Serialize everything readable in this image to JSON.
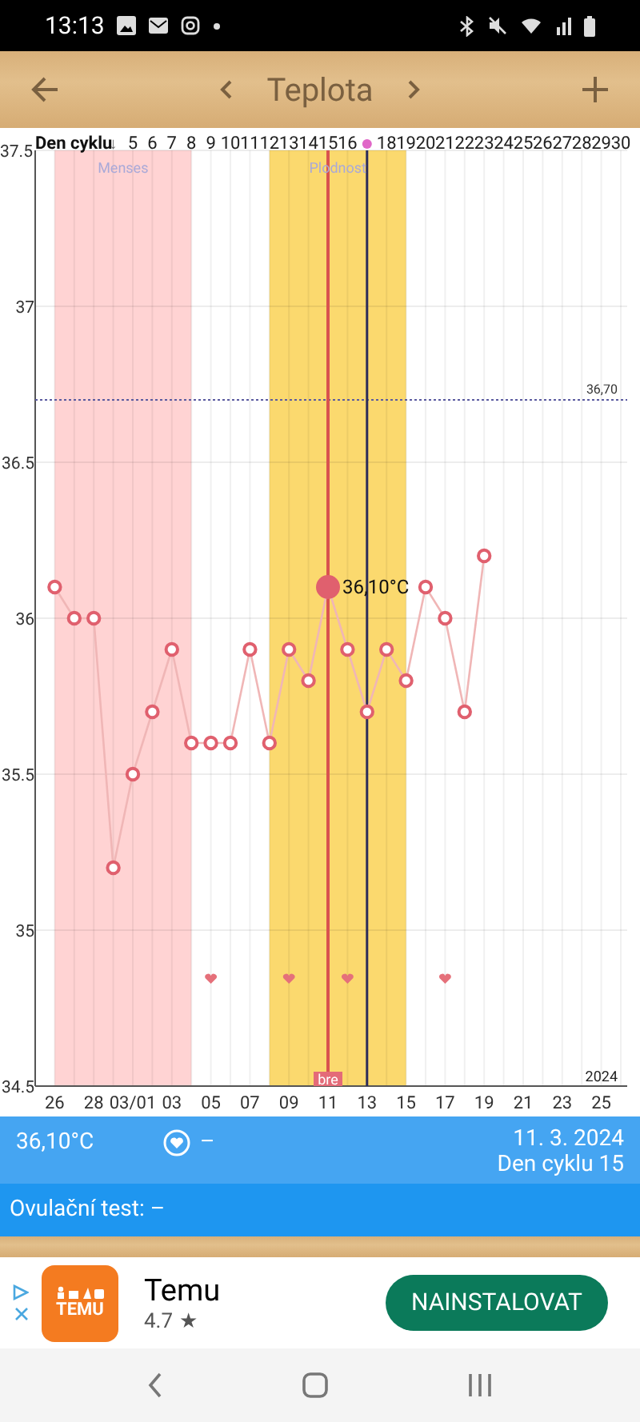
{
  "status_bar": {
    "time": "13:13"
  },
  "header": {
    "title": "Teplota"
  },
  "chart": {
    "cycle_header": {
      "title": "Den cyklu",
      "arrow": "↓",
      "days": [
        {
          "kind": "number",
          "label": "5",
          "heart": false,
          "selected": false
        },
        {
          "kind": "number",
          "label": "6",
          "heart": false,
          "selected": false
        },
        {
          "kind": "number",
          "label": "7",
          "heart": false,
          "selected": false
        },
        {
          "kind": "number",
          "label": "8",
          "heart": false,
          "selected": false
        },
        {
          "kind": "number",
          "label": "9",
          "heart": true,
          "selected": false
        },
        {
          "kind": "number",
          "label": "10",
          "heart": false,
          "selected": false
        },
        {
          "kind": "number",
          "label": "11",
          "heart": false,
          "selected": false
        },
        {
          "kind": "number",
          "label": "12",
          "heart": false,
          "selected": false
        },
        {
          "kind": "number",
          "label": "13",
          "heart": true,
          "selected": false
        },
        {
          "kind": "number",
          "label": "14",
          "heart": false,
          "selected": false
        },
        {
          "kind": "number",
          "label": "15",
          "heart": false,
          "selected": true
        },
        {
          "kind": "number",
          "label": "16",
          "heart": true,
          "selected": false
        },
        {
          "kind": "today",
          "heart": false,
          "selected": false
        },
        {
          "kind": "number",
          "label": "18",
          "heart": false,
          "selected": false
        },
        {
          "kind": "number",
          "label": "19",
          "heart": false,
          "selected": false
        },
        {
          "kind": "number",
          "label": "20",
          "heart": false,
          "selected": false
        },
        {
          "kind": "number",
          "label": "21",
          "heart": true,
          "selected": false
        },
        {
          "kind": "number",
          "label": "22",
          "heart": false,
          "selected": false
        },
        {
          "kind": "number",
          "label": "23",
          "heart": false,
          "selected": false
        },
        {
          "kind": "number",
          "label": "24",
          "heart": false,
          "selected": false
        },
        {
          "kind": "number",
          "label": "25",
          "heart": false,
          "selected": false
        },
        {
          "kind": "number",
          "label": "26",
          "heart": false,
          "selected": false
        },
        {
          "kind": "number",
          "label": "27",
          "heart": false,
          "selected": false
        },
        {
          "kind": "number",
          "label": "28",
          "heart": false,
          "selected": false
        },
        {
          "kind": "number",
          "label": "29",
          "heart": false,
          "selected": false
        },
        {
          "kind": "number",
          "label": "30",
          "heart": false,
          "selected": false
        }
      ]
    },
    "selected_label": "36,10°C",
    "selected_tag": "bre",
    "year": "2024",
    "chart_data": {
      "type": "line",
      "categories": [
        "26",
        null,
        "28",
        null,
        "03/01",
        null,
        "03",
        null,
        "05",
        null,
        "07",
        null,
        "09",
        null,
        "11",
        null,
        "13",
        null,
        "15",
        null,
        "17",
        null,
        "19",
        null,
        "21",
        null,
        "23",
        null,
        "25",
        null
      ],
      "series": [
        {
          "color": "#e0606e",
          "marker": "o",
          "values": [
            36.1,
            36.0,
            36.0,
            35.2,
            35.5,
            35.7,
            35.9,
            35.6,
            35.6,
            35.6,
            35.9,
            35.6,
            35.9,
            35.8,
            36.1,
            35.9,
            35.7,
            35.9,
            35.8,
            36.1,
            36.0,
            35.7,
            36.2,
            null,
            null,
            null,
            null,
            null,
            null,
            null
          ]
        }
      ],
      "ylim": [
        34.5,
        37.5
      ],
      "yticks": [
        {
          "value": 37.5,
          "label": "37.5"
        },
        {
          "value": 37,
          "label": "37"
        },
        {
          "value": 36.5,
          "label": "36.5"
        },
        {
          "value": 36,
          "label": "36"
        },
        {
          "value": 35.5,
          "label": "35.5"
        },
        {
          "value": 35,
          "label": "35"
        },
        {
          "value": 34.5,
          "label": "34.5"
        }
      ],
      "grid": true,
      "ref_lines": [
        {
          "axis": "y",
          "value": 36.7,
          "label": "36,70"
        }
      ]
    },
    "phases": [
      {
        "kind": "menses",
        "label": "Menses"
      },
      {
        "kind": "fertile",
        "label": "Plodnost"
      }
    ]
  },
  "info": {
    "temperature": "36,10°C",
    "sex": "–",
    "date": "11. 3. 2024",
    "cycle_day": "Den cyklu 15"
  },
  "ovulation": {
    "text": "Ovulační test: –"
  },
  "ad": {
    "logo_text": "TEMU",
    "name": "Temu",
    "rating": "4.7",
    "star": "★",
    "button": "NAINSTALOVAT"
  }
}
